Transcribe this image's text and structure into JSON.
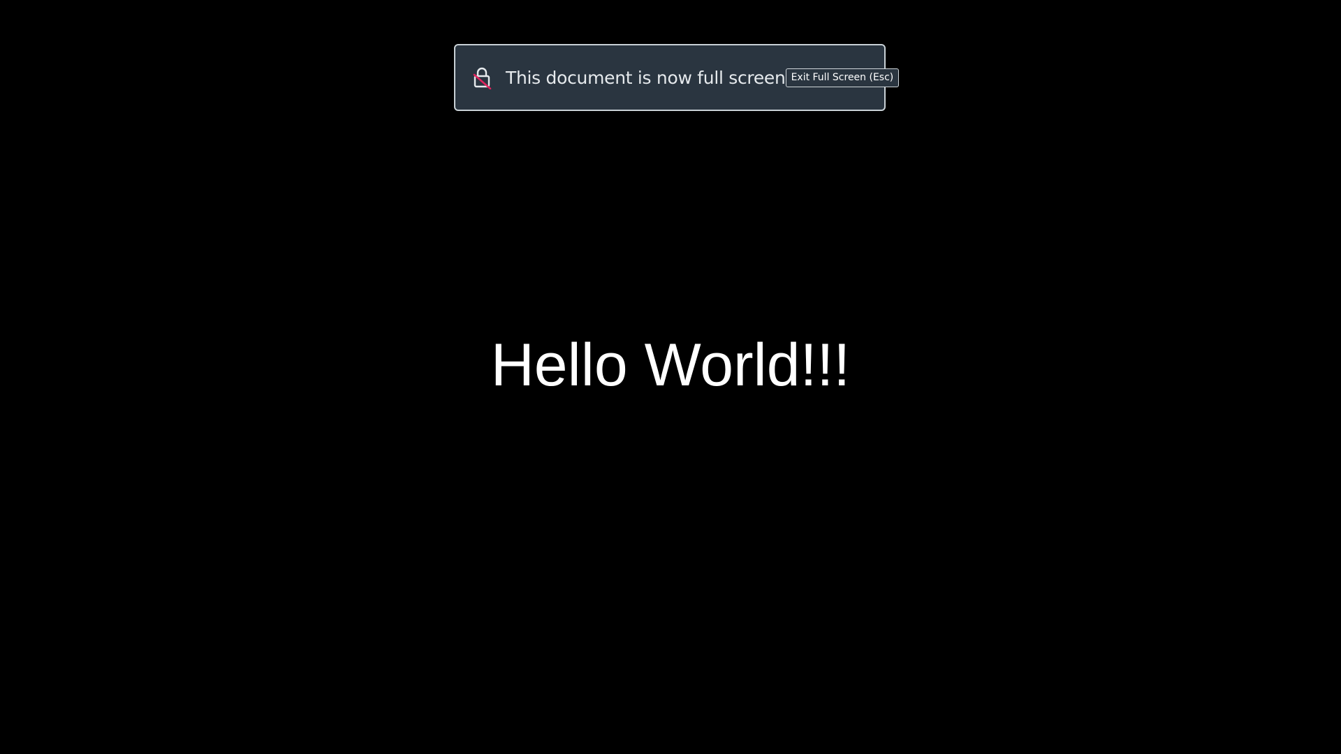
{
  "fullscreen_notice": {
    "message": "This document is now full screen",
    "exit_button_label": "Exit Full Screen (Esc)",
    "icon": "fullscreen-lock-icon"
  },
  "content": {
    "heading": "Hello World!!!"
  },
  "colors": {
    "page_background": "#000000",
    "notice_background": "#2a3540",
    "notice_border": "#c9d1d6",
    "icon_slash": "#e0245e",
    "text": "#ffffff"
  }
}
